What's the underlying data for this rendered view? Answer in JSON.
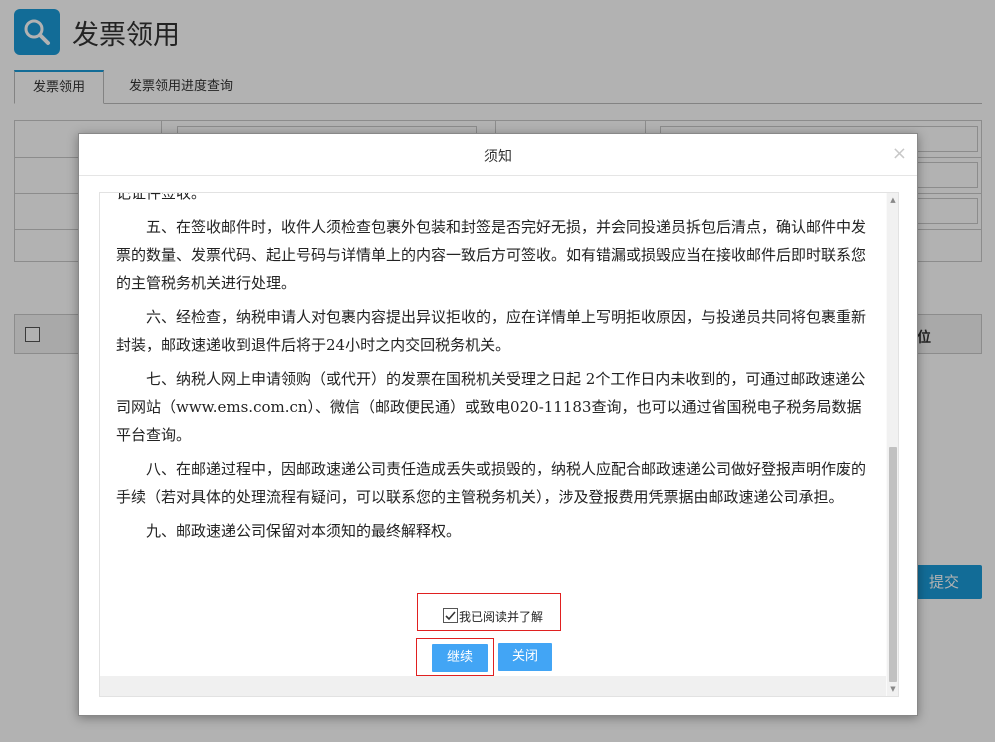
{
  "page": {
    "title": "发票领用",
    "tabs": [
      "发票领用",
      "发票领用进度查询"
    ],
    "table_col_unit": "位",
    "submit_label": "提交"
  },
  "modal": {
    "title": "须知",
    "close_symbol": "×",
    "paragraphs": [
      "记证件签收。",
      "五、在签收邮件时，收件人须检查包裹外包装和封签是否完好无损，并会同投递员拆包后清点，确认邮件中发票的数量、发票代码、起止号码与详情单上的内容一致后方可签收。如有错漏或损毁应当在接收邮件后即时联系您的主管税务机关进行处理。",
      "六、经检查，纳税申请人对包裹内容提出异议拒收的，应在详情单上写明拒收原因，与投递员共同将包裹重新封装，邮政速递收到退件后将于24小时之内交回税务机关。",
      "七、纳税人网上申请领购（或代开）的发票在国税机关受理之日起 2个工作日内未收到的，可通过邮政速递公司网站（www.ems.com.cn）、微信（邮政便民通）或致电020-11183查询，也可以通过省国税电子税务局数据平台查询。",
      "八、在邮递过程中，因邮政速递公司责任造成丢失或损毁的，纳税人应配合邮政速递公司做好登报声明作废的手续（若对具体的处理流程有疑问，可以联系您的主管税务机关），涉及登报费用凭票据由邮政速递公司承担。",
      "九、邮政速递公司保留对本须知的最终解释权。"
    ],
    "confirm_label": "我已阅读并了解",
    "confirm_checked": true,
    "continue_label": "继续",
    "close_label": "关闭"
  },
  "colors": {
    "accent": "#1a9bd8",
    "button": "#42a5f5",
    "highlight_border": "#e02020"
  },
  "icons": {
    "app": "search-icon",
    "close": "close-icon",
    "checkbox": "checkbox-checked-icon"
  }
}
